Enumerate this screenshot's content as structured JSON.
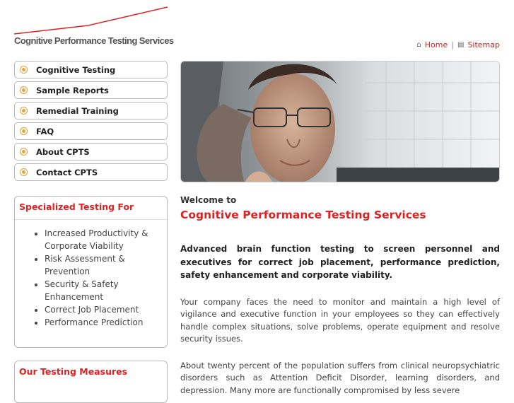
{
  "logo": {
    "text": "Cognitive Performance Testing Services"
  },
  "toplinks": {
    "home_label": "Home",
    "sitemap_label": "Sitemap"
  },
  "nav": {
    "items": [
      {
        "label": "Cognitive Testing"
      },
      {
        "label": "Sample Reports"
      },
      {
        "label": "Remedial Training"
      },
      {
        "label": "FAQ"
      },
      {
        "label": "About CPTS"
      },
      {
        "label": "Contact CPTS"
      }
    ]
  },
  "specialized": {
    "title": "Specialized Testing For",
    "items": [
      "Increased Productivity & Corporate Viability",
      "Risk Assessment & Prevention",
      "Security & Safety Enhancement",
      "Correct Job Placement",
      "Performance Prediction"
    ]
  },
  "measures": {
    "title": "Our Testing Measures"
  },
  "main": {
    "welcome": "Welcome to",
    "title": "Cognitive Performance Testing Services",
    "lead": "Advanced brain function testing to screen personnel and executives for correct job placement, performance prediction, safety enhancement and corporate viability.",
    "para1": "Your company faces the need to monitor and maintain a high level of vigilance and executive function in your employees so they can effectively handle complex situations, solve problems, operate equipment and resolve security issues.",
    "para2": "About twenty percent of the population suffers from clinical neuropsychiatric disorders such as Attention Deficit Disorder, learning disorders, and depression. Many more are functionally compromised by less severe"
  },
  "colors": {
    "accent": "#dd2222",
    "bullet": "#e8a23a"
  }
}
